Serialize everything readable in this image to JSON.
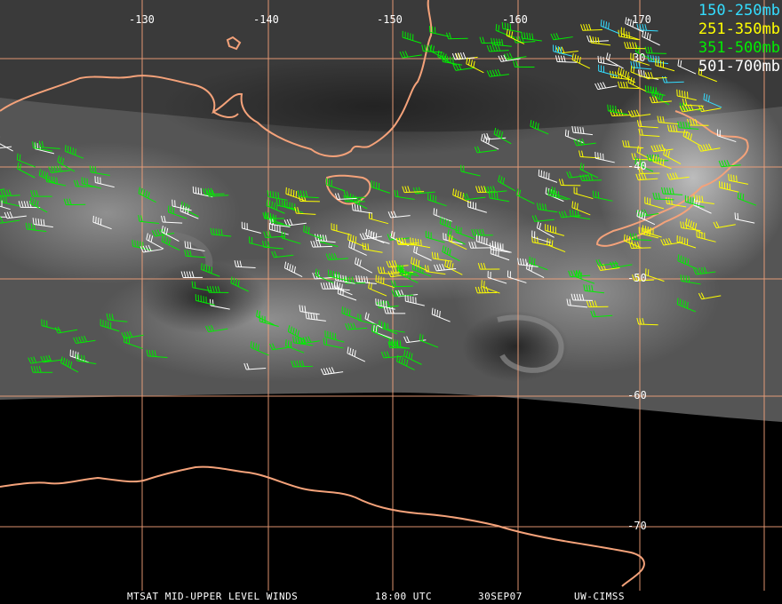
{
  "legend": {
    "levels": [
      {
        "label": "150-250mb",
        "color": "#33ddff"
      },
      {
        "label": "251-350mb",
        "color": "#ffff00"
      },
      {
        "label": "351-500mb",
        "color": "#00ee00"
      },
      {
        "label": "501-700mb",
        "color": "#ffffff"
      }
    ]
  },
  "grid": {
    "color": "#f4a27a",
    "longitudes": [
      "-130",
      "-140",
      "-150",
      "-160",
      "-170"
    ],
    "latitudes": [
      "30",
      "-40",
      "-50",
      "-60",
      "-70"
    ]
  },
  "coast_color": "#f4a27a",
  "footer": {
    "product": "MTSAT MID-UPPER LEVEL WINDS",
    "time": "18:00 UTC",
    "date": "30SEP07",
    "source": "UW-CIMSS"
  }
}
